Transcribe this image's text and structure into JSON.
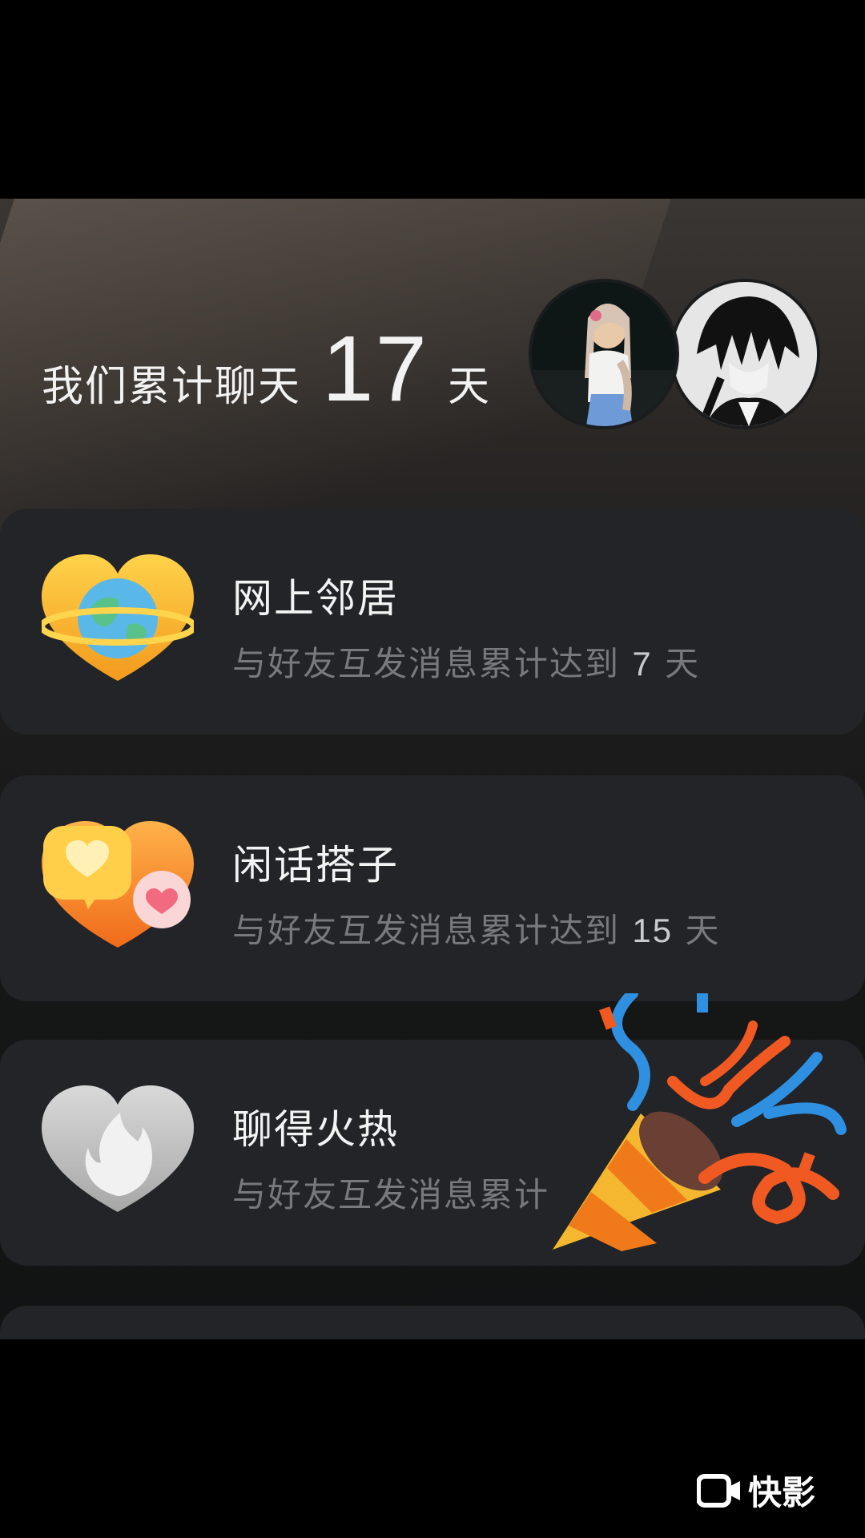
{
  "summary": {
    "prefix": "我们累计聊天",
    "days": "17",
    "unit": "天"
  },
  "avatars": {
    "left": "friend-avatar-girl",
    "right": "user-avatar-anime"
  },
  "cards": [
    {
      "title": "网上邻居",
      "desc_prefix": "与好友互发消息累计达到",
      "desc_num": "7",
      "desc_unit": "天",
      "icon": "heart-planet-icon",
      "status": "unlocked"
    },
    {
      "title": "闲话搭子",
      "desc_prefix": "与好友互发消息累计达到",
      "desc_num": "15",
      "desc_unit": "天",
      "icon": "heart-chat-bubbles-icon",
      "status": "unlocked"
    },
    {
      "title": "聊得火热",
      "desc_prefix": "与好友互发消息累计",
      "desc_num": "",
      "desc_unit": "",
      "icon": "heart-flame-icon",
      "status": "locked"
    }
  ],
  "overlay": {
    "icon": "party-popper-icon"
  },
  "watermark": {
    "label": "快影",
    "icon": "camera-icon"
  },
  "colors": {
    "card_bg": "#222428",
    "title": "#f3f3f3",
    "desc": "#77797e",
    "gold": "#f6b52a",
    "orange": "#f07a1a"
  }
}
